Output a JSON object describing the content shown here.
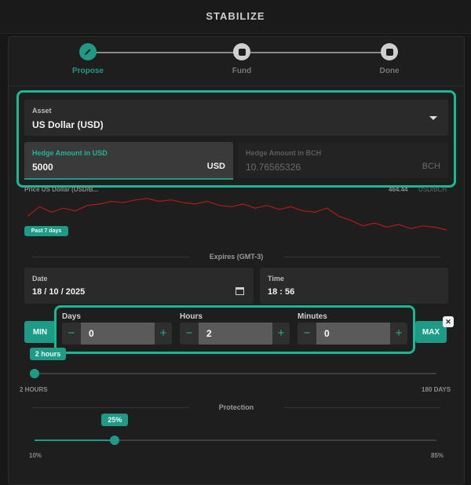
{
  "app": {
    "title": "STABILIZE"
  },
  "stepper": {
    "steps": [
      {
        "label": "Propose",
        "state": "active"
      },
      {
        "label": "Fund",
        "state": "todo"
      },
      {
        "label": "Done",
        "state": "todo"
      }
    ]
  },
  "asset": {
    "label": "Asset",
    "value": "US Dollar (USD)"
  },
  "hedge_usd": {
    "label": "Hedge Amount in USD",
    "value": "5000",
    "unit": "USD"
  },
  "hedge_bch": {
    "label": "Hedge Amount in BCH",
    "value": "10.76565326",
    "unit": "BCH"
  },
  "price": {
    "label": "Price US Dollar (USD/B...",
    "value": "464.44",
    "unit": "USD/BCH"
  },
  "chart": {
    "period_badge": "Past 7 days"
  },
  "chart_data": {
    "type": "line",
    "title": "",
    "xlabel": "",
    "ylabel": "",
    "series": [
      {
        "values": [
          455,
          462,
          458,
          461,
          459,
          463,
          464,
          466,
          465,
          467,
          468,
          466,
          467,
          465,
          464,
          466,
          463,
          462,
          464,
          461,
          463,
          460,
          462,
          459,
          458,
          461,
          455,
          452,
          448,
          450,
          447,
          449,
          446,
          448,
          447,
          445
        ]
      }
    ]
  },
  "expires": {
    "label": "Expires (GMT-3)"
  },
  "date": {
    "label": "Date",
    "value": "18 / 10 / 2025",
    "icon": "calendar-icon"
  },
  "time": {
    "label": "Time",
    "value": "18 : 56"
  },
  "duration": {
    "min_label": "MIN",
    "max_label": "MAX",
    "close_icon": "close-icon",
    "days": {
      "label": "Days",
      "value": "0"
    },
    "hours": {
      "label": "Hours",
      "value": "2"
    },
    "minutes": {
      "label": "Minutes",
      "value": "0"
    },
    "slider_badge": "2 hours",
    "slider_min": "2 HOURS",
    "slider_max": "180 DAYS",
    "slider_position": 0.0
  },
  "protection": {
    "label": "Protection",
    "badge": "25%",
    "min": "10%",
    "max": "85%",
    "value_percent": 25
  },
  "colors": {
    "accent": "#1f9a86",
    "highlight": "#19b894",
    "chart_line": "#b01a1a",
    "background": "#171717"
  }
}
